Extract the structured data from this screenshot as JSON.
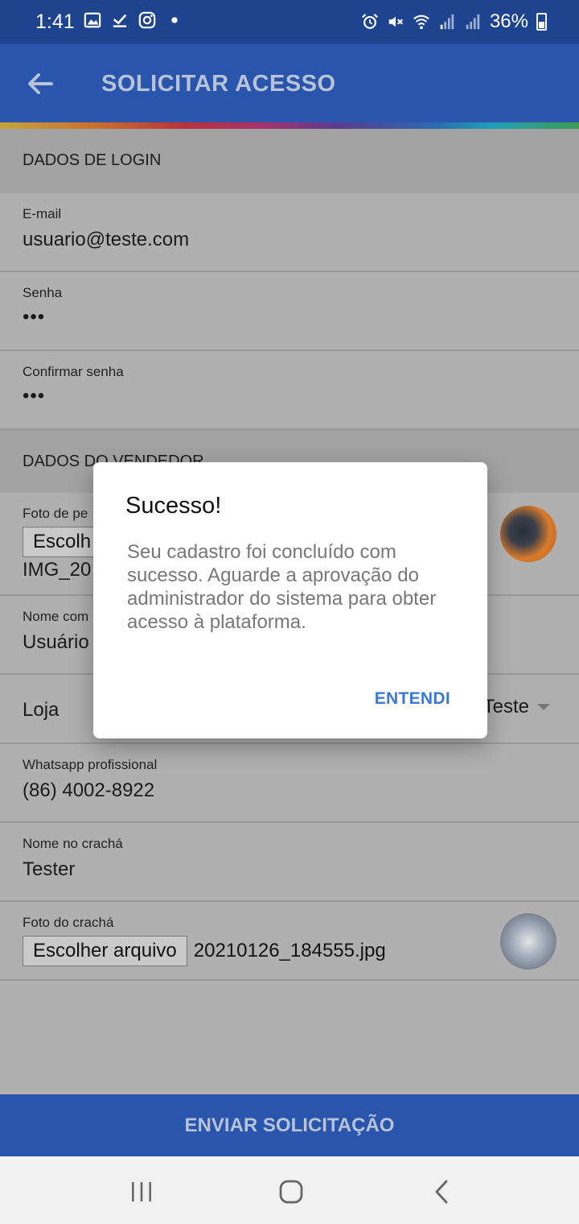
{
  "status_bar": {
    "time": "1:41",
    "battery_percent": "36%",
    "icons": [
      "gallery-icon",
      "download-done-icon",
      "instagram-icon",
      "dot-icon",
      "alarm-icon",
      "mute-icon",
      "wifi-icon",
      "signal-icon",
      "signal-icon",
      "battery-icon"
    ]
  },
  "app_bar": {
    "title": "SOLICITAR ACESSO",
    "back_icon": "arrow-left-icon"
  },
  "login_section": {
    "header": "DADOS DE LOGIN",
    "email_label": "E-mail",
    "email_value": "usuario@teste.com",
    "password_label": "Senha",
    "password_value": "•••",
    "confirm_label": "Confirmar senha",
    "confirm_value": "•••"
  },
  "seller_section": {
    "header": "DADOS DO VENDEDOR",
    "photo_label": "Foto de pe",
    "photo_button": "Escolh",
    "photo_file": "IMG_20",
    "name_label": "Nome com",
    "name_value": "Usuário",
    "store_label": "Loja",
    "store_value": "Teste",
    "whatsapp_label": "Whatsapp profissional",
    "whatsapp_value": "(86) 4002-8922",
    "badge_name_label": "Nome no crachá",
    "badge_name_value": "Tester",
    "badge_photo_label": "Foto do crachá",
    "badge_photo_button": "Escolher arquivo",
    "badge_photo_file": "20210126_184555.jpg"
  },
  "submit_button": "ENVIAR SOLICITAÇÃO",
  "dialog": {
    "title": "Sucesso!",
    "message": "Seu cadastro foi concluído com sucesso. Aguarde a aprovação do administrador do sistema para obter acesso à plataforma.",
    "button": "ENTENDI"
  },
  "colors": {
    "status_bar": "#1e448f",
    "app_bar": "#2955ad",
    "dialog_button": "#3b78d8",
    "overlay_content": "#b0b0b0"
  }
}
